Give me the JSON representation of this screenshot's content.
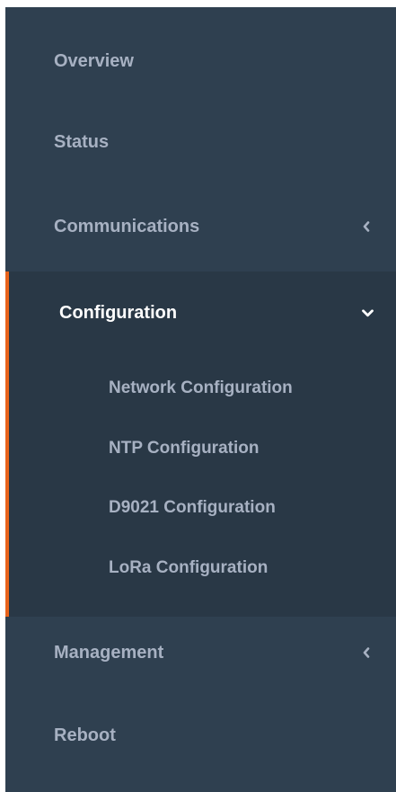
{
  "sidebar": {
    "items": [
      {
        "label": "Overview"
      },
      {
        "label": "Status"
      },
      {
        "label": "Communications"
      },
      {
        "label": "Configuration",
        "expanded": true,
        "children": [
          {
            "label": "Network Configuration"
          },
          {
            "label": "NTP Configuration"
          },
          {
            "label": "D9021 Configuration"
          },
          {
            "label": "LoRa Configuration"
          }
        ]
      },
      {
        "label": "Management"
      },
      {
        "label": "Reboot"
      }
    ]
  },
  "icons": {
    "collapsed_arrow": "chevron-left-icon",
    "expanded_arrow": "chevron-down-icon"
  },
  "colors": {
    "sidebar_bg": "#2f4050",
    "active_bg": "#293846",
    "accent": "#e8631b",
    "text": "#a7b1c2",
    "active_text": "#ffffff"
  }
}
